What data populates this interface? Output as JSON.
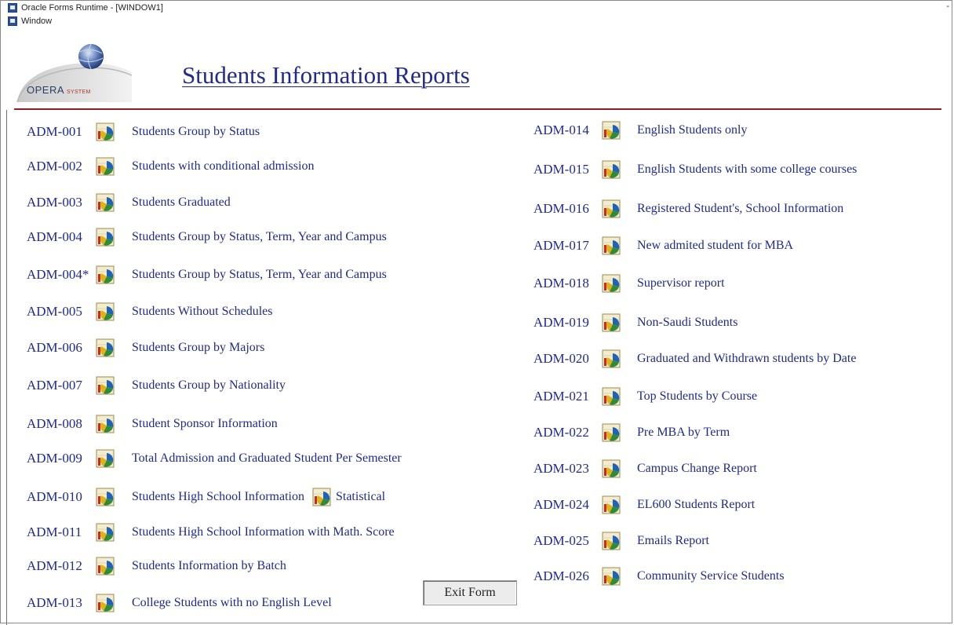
{
  "window": {
    "title": "Oracle Forms Runtime - [WINDOW1]",
    "menu_label": "Window",
    "minimize_glyph": "-"
  },
  "header": {
    "title": "Students Information Reports",
    "logo_word": "OPERA",
    "logo_sub": "SYSTEM"
  },
  "icons": {
    "report_icon": "report-chart-icon",
    "app_icon": "oracle-forms-icon"
  },
  "colors": {
    "link": "#1f2a8c",
    "divider": "#8c1f1f"
  },
  "left_reports": [
    {
      "code": "ADM-001",
      "label": "Students Group by Status"
    },
    {
      "code": "ADM-002",
      "label": "Students with conditional admission"
    },
    {
      "code": "ADM-003",
      "label": "Students Graduated"
    },
    {
      "code": "ADM-004",
      "label": "Students Group by Status, Term, Year and Campus"
    },
    {
      "code": "ADM-004*",
      "label": "Students Group by Status, Term, Year and Campus"
    },
    {
      "code": "ADM-005",
      "label": "Students Without Schedules"
    },
    {
      "code": "ADM-006",
      "label": "Students Group by Majors"
    },
    {
      "code": "ADM-007",
      "label": "Students Group by Nationality"
    },
    {
      "code": "ADM-008",
      "label": "Student Sponsor Information"
    },
    {
      "code": "ADM-009",
      "label": "Total Admission and Graduated Student Per Semester"
    },
    {
      "code": "ADM-010",
      "label": "Students High School Information",
      "extra_label": "Statistical"
    },
    {
      "code": "ADM-011",
      "label": "Students High School Information with Math. Score"
    },
    {
      "code": "ADM-012",
      "label": "Students Information by Batch"
    },
    {
      "code": "ADM-013",
      "label": "College Students with no English Level"
    }
  ],
  "right_reports": [
    {
      "code": "ADM-014",
      "label": "English Students only"
    },
    {
      "code": "ADM-015",
      "label": "English Students with some college courses"
    },
    {
      "code": "ADM-016",
      "label": "Registered Student's, School Information"
    },
    {
      "code": "ADM-017",
      "label": "New admited student for MBA"
    },
    {
      "code": "ADM-018",
      "label": "Supervisor report"
    },
    {
      "code": "ADM-019",
      "label": "Non-Saudi Students"
    },
    {
      "code": "ADM-020",
      "label": "Graduated and Withdrawn students by Date"
    },
    {
      "code": "ADM-021",
      "label": "Top Students by Course"
    },
    {
      "code": "ADM-022",
      "label": "Pre MBA by Term"
    },
    {
      "code": "ADM-023",
      "label": "Campus Change Report"
    },
    {
      "code": "ADM-024",
      "label": "EL600 Students Report"
    },
    {
      "code": "ADM-025",
      "label": "Emails Report"
    },
    {
      "code": "ADM-026",
      "label": "Community Service Students"
    }
  ],
  "buttons": {
    "exit_label": "Exit Form"
  }
}
